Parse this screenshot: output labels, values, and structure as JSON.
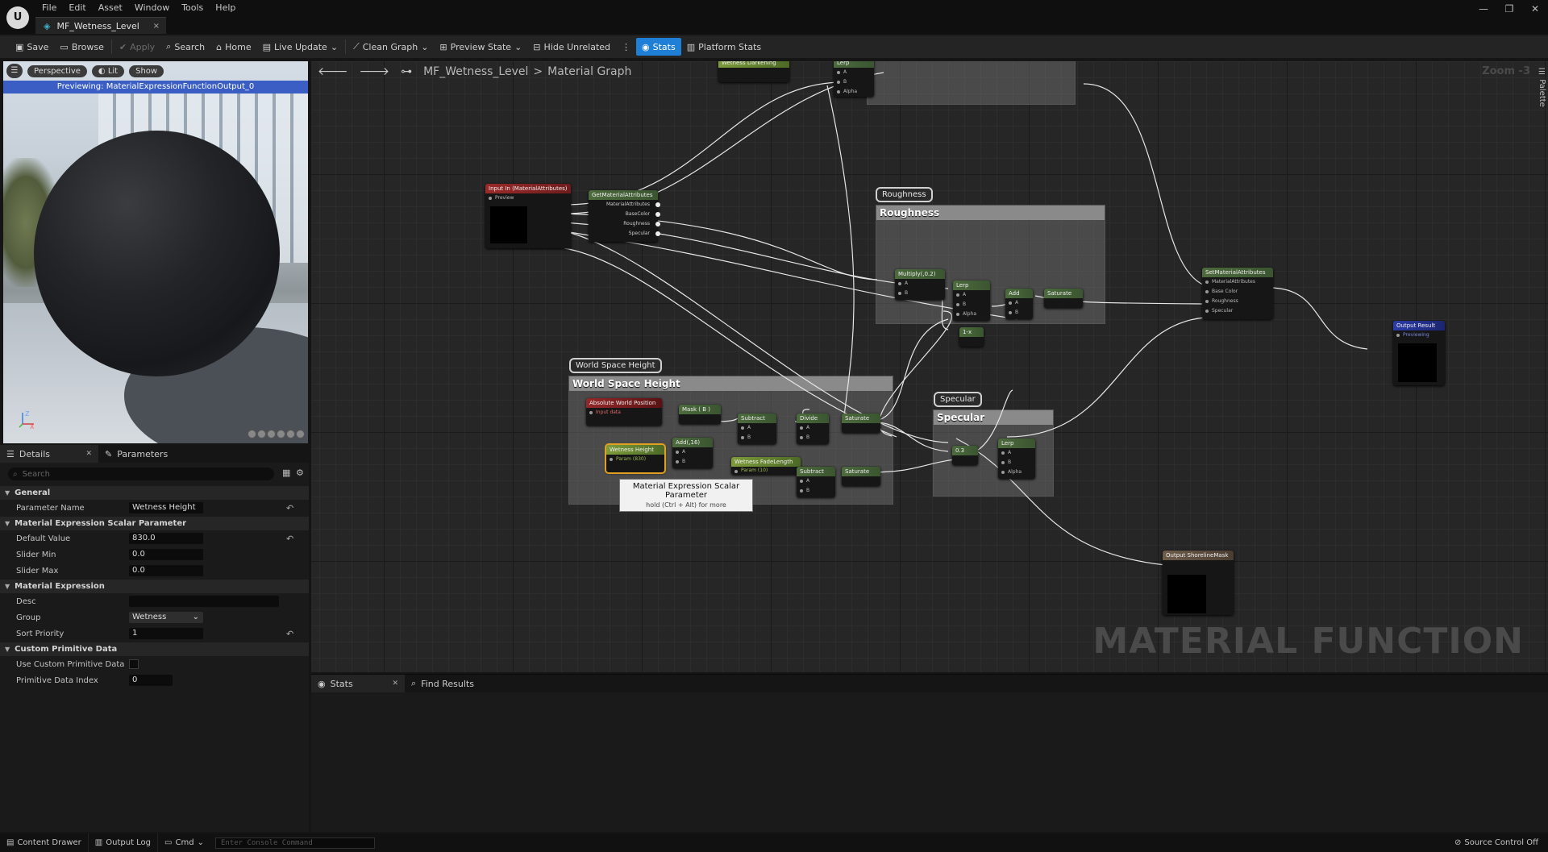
{
  "menu": [
    "File",
    "Edit",
    "Asset",
    "Window",
    "Tools",
    "Help"
  ],
  "window_controls": [
    "—",
    "❐",
    "✕"
  ],
  "tab": {
    "title": "MF_Wetness_Level",
    "close": "×"
  },
  "toolbar": {
    "save": "Save",
    "browse": "Browse",
    "apply": "Apply",
    "search": "Search",
    "home": "Home",
    "live_update": "Live Update",
    "clean_graph": "Clean Graph",
    "preview_state": "Preview State",
    "hide_unrelated": "Hide Unrelated",
    "stats": "Stats",
    "platform_stats": "Platform Stats"
  },
  "viewport": {
    "perspective": "Perspective",
    "lit": "Lit",
    "show": "Show",
    "previewing": "Previewing: MaterialExpressionFunctionOutput_0"
  },
  "details": {
    "tab_details": "Details",
    "tab_parameters": "Parameters",
    "search_placeholder": "Search",
    "categories": {
      "general": "General",
      "scalar": "Material Expression Scalar Parameter",
      "expression": "Material Expression",
      "custom_primitive": "Custom Primitive Data"
    },
    "props": {
      "parameter_name_label": "Parameter Name",
      "parameter_name_value": "Wetness Height",
      "default_value_label": "Default Value",
      "default_value": "830.0",
      "slider_min_label": "Slider Min",
      "slider_min": "0.0",
      "slider_max_label": "Slider Max",
      "slider_max": "0.0",
      "desc_label": "Desc",
      "desc_value": "",
      "group_label": "Group",
      "group_value": "Wetness",
      "sort_priority_label": "Sort Priority",
      "sort_priority": "1",
      "use_custom_primitive_label": "Use Custom Primitive Data",
      "primitive_index_label": "Primitive Data Index",
      "primitive_index": "0"
    }
  },
  "graph": {
    "breadcrumb_asset": "MF_Wetness_Level",
    "breadcrumb_sep": ">",
    "breadcrumb_graph": "Material Graph",
    "zoom": "Zoom -3",
    "palette": "Palette",
    "watermark": "MATERIAL FUNCTION",
    "comments": {
      "roughness_bubble": "Roughness",
      "roughness_title": "Roughness",
      "wsh_bubble": "World Space Height",
      "wsh_title": "World Space Height",
      "specular_bubble": "Specular",
      "specular_title": "Specular"
    },
    "nodes": {
      "input_in": {
        "title": "Input In (MaterialAttributes)",
        "pin": "Preview"
      },
      "get_attr": {
        "title": "GetMaterialAttributes",
        "pins": [
          "MaterialAttributes",
          "BaseColor",
          "Roughness",
          "Specular"
        ]
      },
      "multiply": {
        "title": "Multiply(,0.2)",
        "pins": [
          "A",
          "B"
        ]
      },
      "lerp_rough": {
        "title": "Lerp",
        "pins": [
          "A",
          "B",
          "Alpha"
        ]
      },
      "add": {
        "title": "Add",
        "pins": [
          "A",
          "B"
        ]
      },
      "saturate_rough": {
        "title": "Saturate"
      },
      "one_minus": {
        "title": "1-x"
      },
      "set_attr": {
        "title": "SetMaterialAttributes",
        "pins": [
          "MaterialAttributes",
          "Base Color",
          "Roughness",
          "Specular"
        ]
      },
      "output_result": {
        "title": "Output Result",
        "sub": "Previewing"
      },
      "output_shoreline": {
        "title": "Output ShorelineMask"
      },
      "abs_world_pos": {
        "title": "Absolute World Position",
        "sub": "Input data"
      },
      "mask_b": {
        "title": "Mask ( B )"
      },
      "subtract1": {
        "title": "Subtract",
        "pins": [
          "A",
          "B"
        ]
      },
      "divide": {
        "title": "Divide",
        "pins": [
          "A",
          "B"
        ]
      },
      "saturate1": {
        "title": "Saturate"
      },
      "wetness_height": {
        "title": "Wetness Height",
        "sub": "Param (830)"
      },
      "add16": {
        "title": "Add(,16)",
        "pins": [
          "A",
          "B"
        ]
      },
      "wetness_fade": {
        "title": "Wetness FadeLength",
        "sub": "Param (10)"
      },
      "subtract2": {
        "title": "Subtract",
        "pins": [
          "A",
          "B"
        ]
      },
      "saturate2": {
        "title": "Saturate"
      },
      "spec_const": {
        "title": "0.3"
      },
      "lerp_spec": {
        "title": "Lerp",
        "pins": [
          "A",
          "B",
          "Alpha"
        ]
      },
      "wetness_darkening": {
        "title": "Wetness Darkening"
      },
      "top_lerp": {
        "title": "Lerp",
        "pins": [
          "A",
          "B",
          "Alpha"
        ]
      }
    },
    "tooltip": {
      "title": "Material Expression Scalar Parameter",
      "hint": "hold (Ctrl + Alt) for more"
    }
  },
  "bottom_panel": {
    "stats_tab": "Stats",
    "find_results_tab": "Find Results"
  },
  "statusbar": {
    "content_drawer": "Content Drawer",
    "output_log": "Output Log",
    "cmd": "Cmd",
    "console_placeholder": "Enter Console Command",
    "source_control": "Source Control Off"
  },
  "colors": {
    "accent": "#1f7fd6",
    "preview_banner": "#3a5ec4",
    "selection": "#e0a020"
  }
}
